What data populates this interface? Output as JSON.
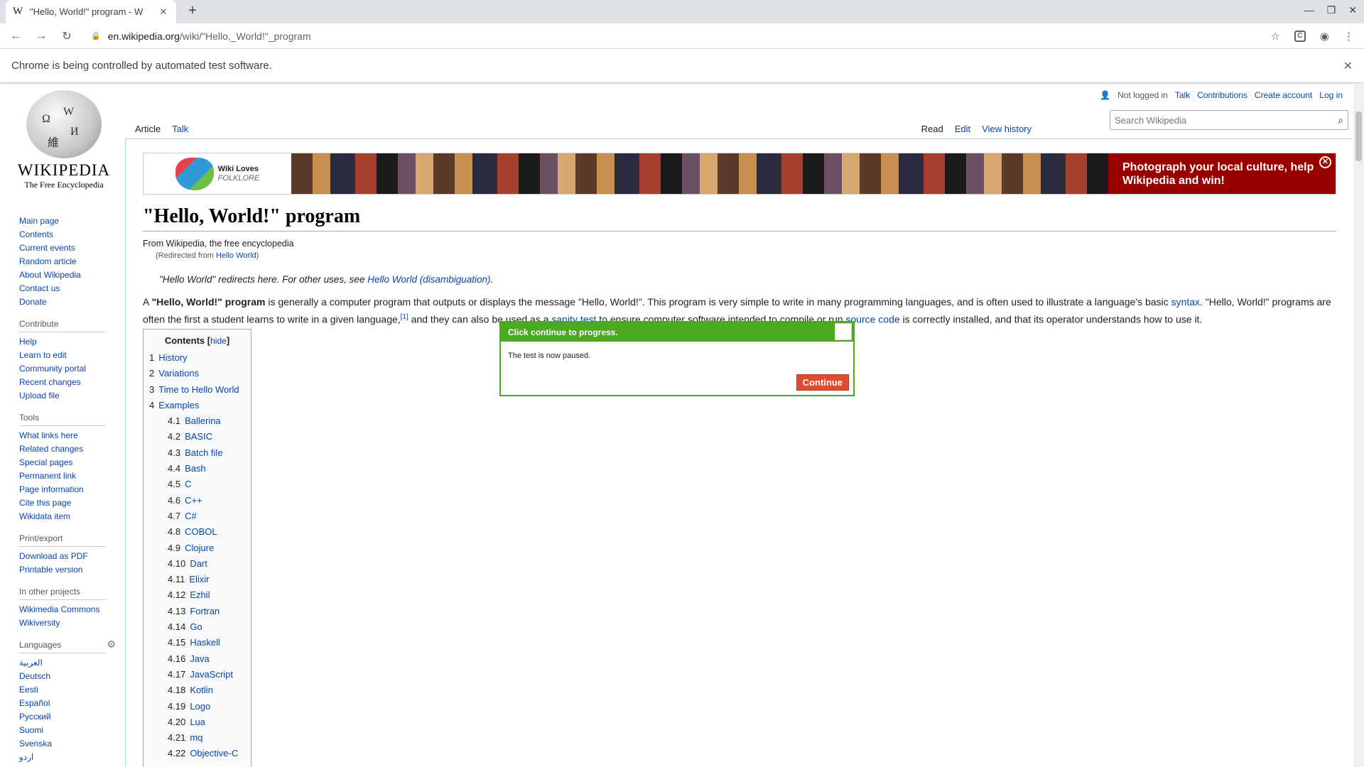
{
  "browser": {
    "tab_title": "\"Hello, World!\" program - W",
    "tab_favicon": "W",
    "url_host": "en.wikipedia.org",
    "url_path": "/wiki/\"Hello,_World!\"_program",
    "infobar": "Chrome is being controlled by automated test software."
  },
  "logo": {
    "wordmark": "WIKIPEDIA",
    "tagline": "The Free Encyclopedia"
  },
  "nav": {
    "main": [
      "Main page",
      "Contents",
      "Current events",
      "Random article",
      "About Wikipedia",
      "Contact us",
      "Donate"
    ],
    "contribute_heading": "Contribute",
    "contribute": [
      "Help",
      "Learn to edit",
      "Community portal",
      "Recent changes",
      "Upload file"
    ],
    "tools_heading": "Tools",
    "tools": [
      "What links here",
      "Related changes",
      "Special pages",
      "Permanent link",
      "Page information",
      "Cite this page",
      "Wikidata item"
    ],
    "print_heading": "Print/export",
    "print": [
      "Download as PDF",
      "Printable version"
    ],
    "projects_heading": "In other projects",
    "projects": [
      "Wikimedia Commons",
      "Wikiversity"
    ],
    "languages_heading": "Languages",
    "languages": [
      "العربية",
      "Deutsch",
      "Eesti",
      "Español",
      "Русский",
      "Suomi",
      "Svenska",
      "اردو"
    ]
  },
  "personal": {
    "status": "Not logged in",
    "talk": "Talk",
    "contributions": "Contributions",
    "create": "Create account",
    "login": "Log in"
  },
  "tabs": {
    "article": "Article",
    "talk": "Talk",
    "read": "Read",
    "edit": "Edit",
    "history": "View history"
  },
  "search": {
    "placeholder": "Search Wikipedia"
  },
  "banner": {
    "wlf_line1": "Wiki Loves",
    "wlf_line2": "FOLKLORE",
    "cta": "Photograph your local culture, help Wikipedia and win!"
  },
  "article": {
    "title": "\"Hello, World!\" program",
    "from": "From Wikipedia, the free encyclopedia",
    "redirect_prefix": "(Redirected from ",
    "redirect_link": "Hello World",
    "redirect_suffix": ")",
    "hatnote_prefix": "\"Hello World\" redirects here. For other uses, see ",
    "hatnote_link": "Hello World (disambiguation)",
    "hatnote_suffix": ".",
    "p1_a": "A ",
    "p1_bold": "\"Hello, World!\" program",
    "p1_b": " is generally a computer program that outputs or displays the message \"Hello, World!\". This program is very simple to write in many programming languages, and is often used to illustrate a language's basic ",
    "p1_link1": "syntax",
    "p1_c": ". \"Hello, World!\" programs are often the first a student learns to write in a given language,",
    "p1_ref": "[1]",
    "p1_d": " and they can also be used as a ",
    "p1_link2": "sanity test",
    "p1_e": " to ensure computer software intended to compile or run ",
    "p1_link3": "source code",
    "p1_f": " is correctly installed, and that its operator understands how to use it."
  },
  "toc": {
    "title": "Contents",
    "hide": "hide",
    "items": [
      {
        "n": "1",
        "t": "History",
        "sub": false
      },
      {
        "n": "2",
        "t": "Variations",
        "sub": false
      },
      {
        "n": "3",
        "t": "Time to Hello World",
        "sub": false
      },
      {
        "n": "4",
        "t": "Examples",
        "sub": false
      },
      {
        "n": "4.1",
        "t": "Ballerina",
        "sub": true
      },
      {
        "n": "4.2",
        "t": "BASIC",
        "sub": true
      },
      {
        "n": "4.3",
        "t": "Batch file",
        "sub": true
      },
      {
        "n": "4.4",
        "t": "Bash",
        "sub": true
      },
      {
        "n": "4.5",
        "t": "C",
        "sub": true
      },
      {
        "n": "4.6",
        "t": "C++",
        "sub": true
      },
      {
        "n": "4.7",
        "t": "C#",
        "sub": true
      },
      {
        "n": "4.8",
        "t": "COBOL",
        "sub": true
      },
      {
        "n": "4.9",
        "t": "Clojure",
        "sub": true
      },
      {
        "n": "4.10",
        "t": "Dart",
        "sub": true
      },
      {
        "n": "4.11",
        "t": "Elixir",
        "sub": true
      },
      {
        "n": "4.12",
        "t": "Ezhil",
        "sub": true
      },
      {
        "n": "4.13",
        "t": "Fortran",
        "sub": true
      },
      {
        "n": "4.14",
        "t": "Go",
        "sub": true
      },
      {
        "n": "4.15",
        "t": "Haskell",
        "sub": true
      },
      {
        "n": "4.16",
        "t": "Java",
        "sub": true
      },
      {
        "n": "4.17",
        "t": "JavaScript",
        "sub": true
      },
      {
        "n": "4.18",
        "t": "Kotlin",
        "sub": true
      },
      {
        "n": "4.19",
        "t": "Logo",
        "sub": true
      },
      {
        "n": "4.20",
        "t": "Lua",
        "sub": true
      },
      {
        "n": "4.21",
        "t": "mq",
        "sub": true
      },
      {
        "n": "4.22",
        "t": "Objective-C",
        "sub": true
      }
    ]
  },
  "modal": {
    "title": "Click continue to progress.",
    "body": "The test is now paused.",
    "button": "Continue"
  },
  "colors": {
    "link": "#0645ad",
    "modal_green": "#4ca81f",
    "continue_red": "#e04a30",
    "banner_red": "#990000"
  }
}
